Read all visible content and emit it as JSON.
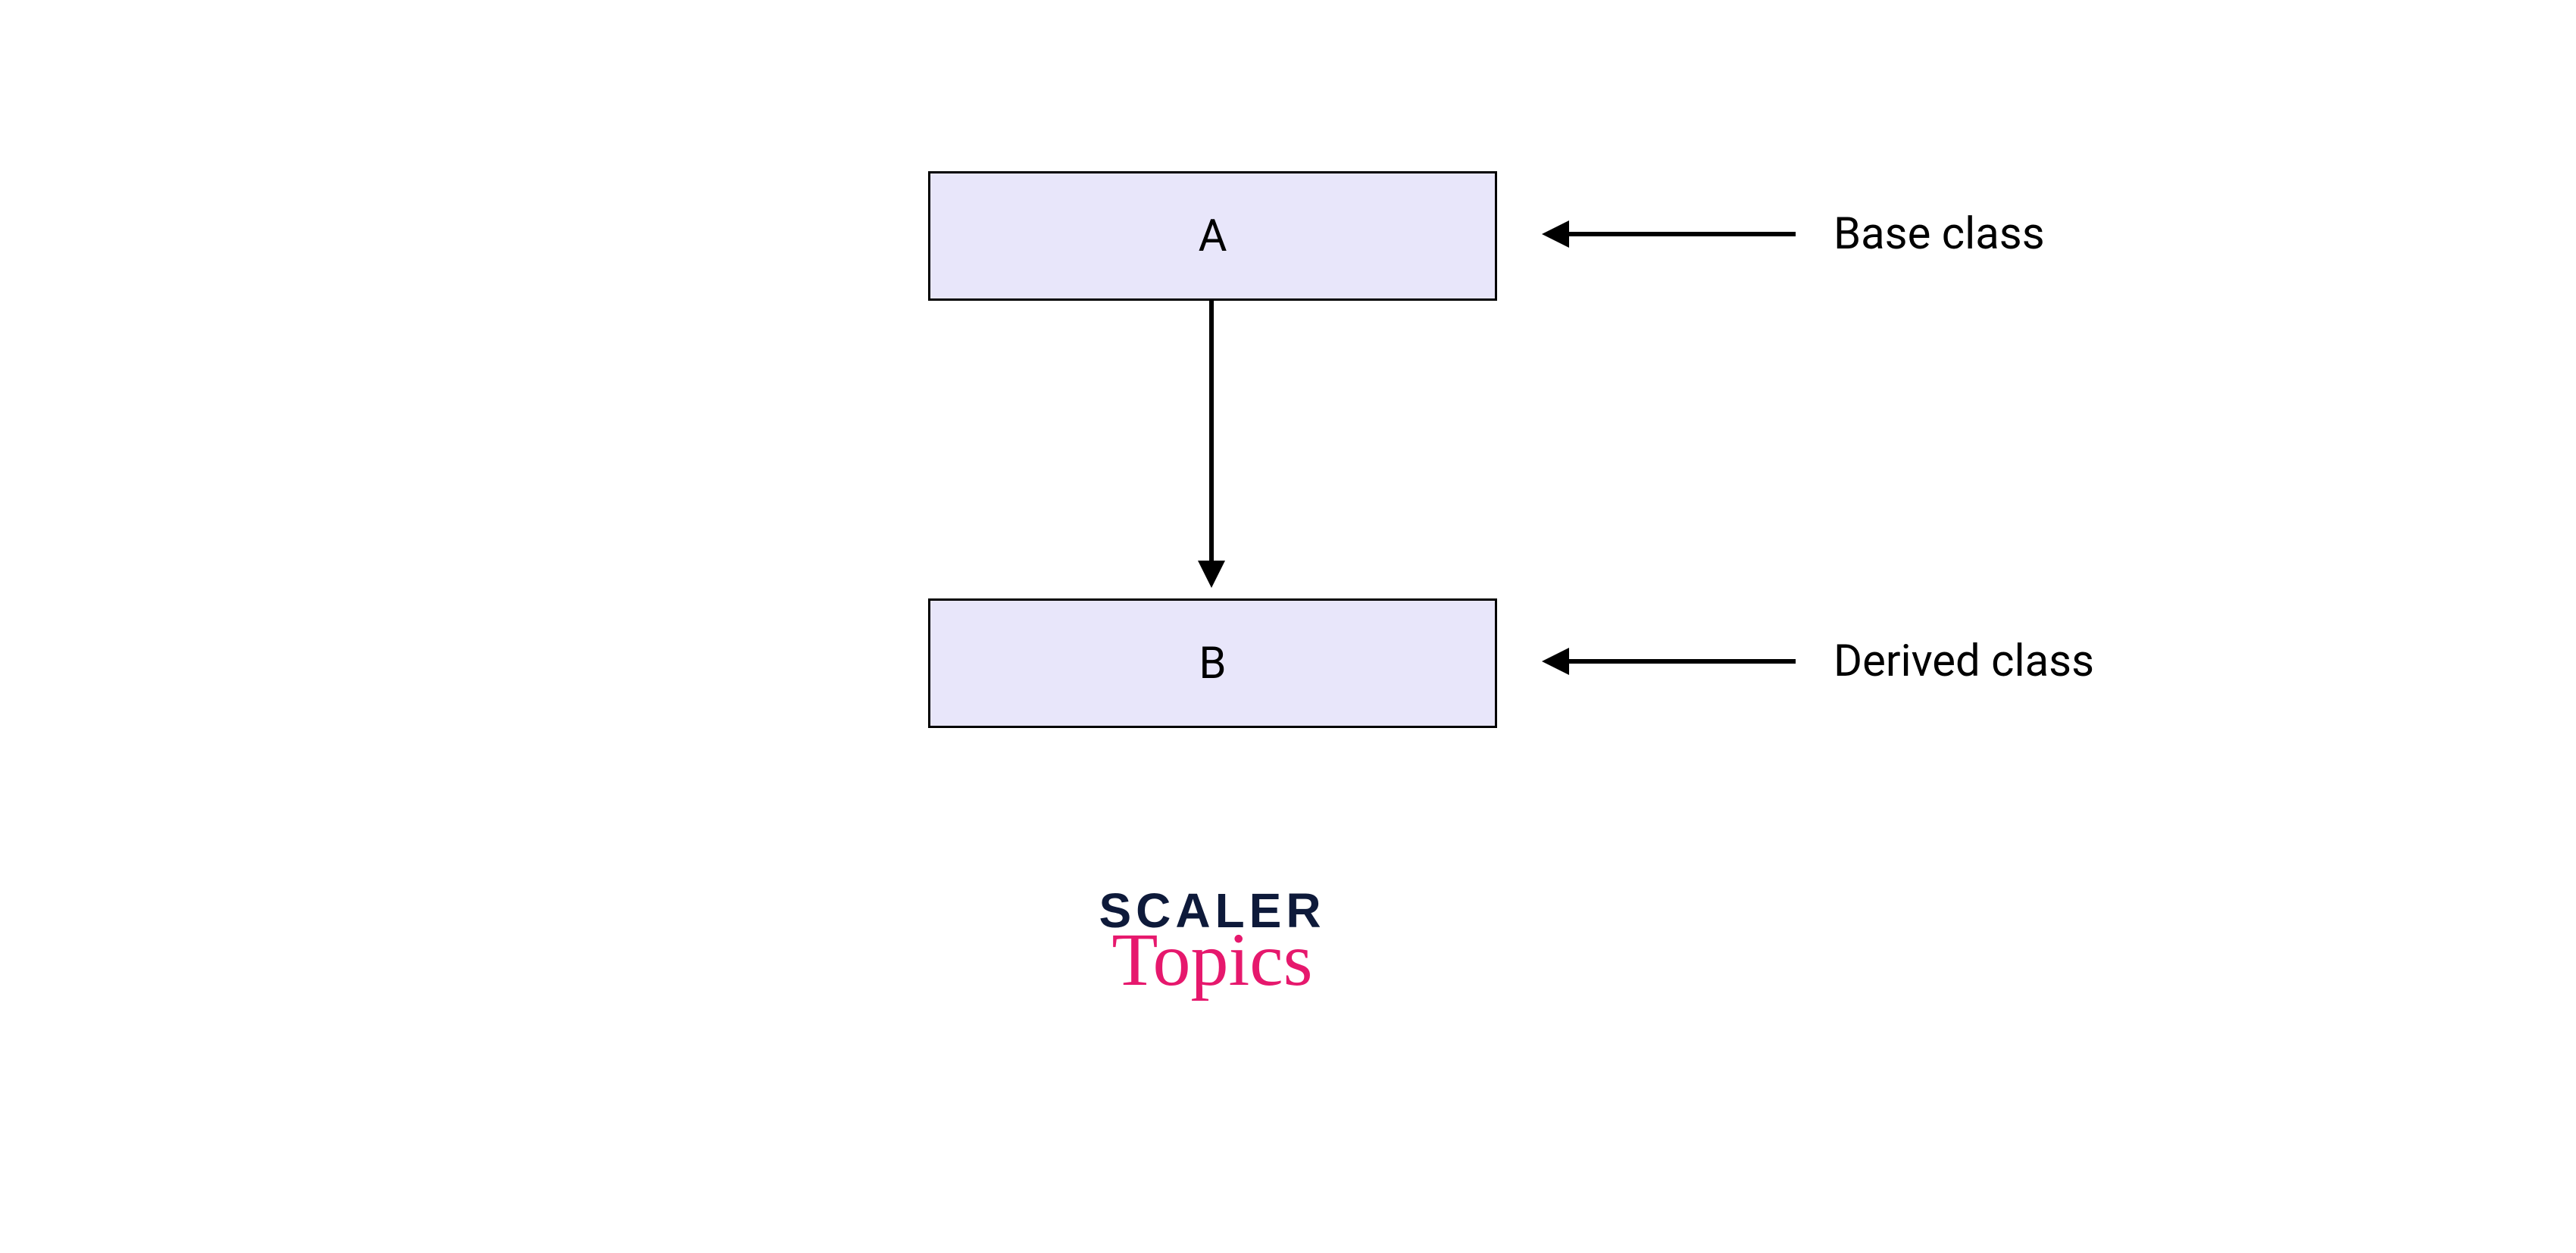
{
  "diagram": {
    "boxA": {
      "label": "A"
    },
    "boxB": {
      "label": "B"
    },
    "labelBase": "Base class",
    "labelDerived": "Derived class"
  },
  "logo": {
    "line1": "SCALER",
    "line2": "Topics"
  },
  "colors": {
    "boxFill": "#e8e6fa",
    "boxStroke": "#000000",
    "text": "#000000",
    "logoDark": "#0e1a3a",
    "logoAccent": "#e6186d"
  }
}
